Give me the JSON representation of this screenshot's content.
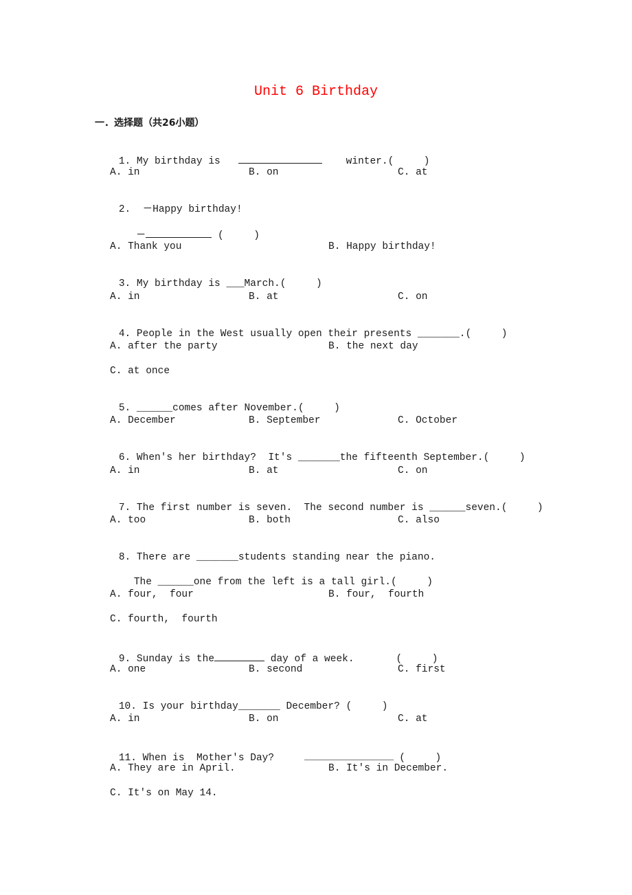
{
  "title": "Unit 6 Birthday",
  "section_heading": "一．选择题（共26小题）",
  "questions": [
    {
      "number": "1.",
      "text_before": "My birthday is",
      "text_after": "winter.",
      "paren": "(     )",
      "options": [
        "A. in",
        "B. on",
        "C. at"
      ]
    },
    {
      "number": "2.",
      "line1": "－Happy birthday!",
      "line2_prefix": "－",
      "paren": "(     )",
      "options": [
        "A. Thank you",
        "B. Happy birthday!"
      ]
    },
    {
      "number": "3.",
      "text": "My birthday is ___March.",
      "paren": "(     )",
      "options": [
        "A. in",
        "B. at",
        "C. on"
      ]
    },
    {
      "number": "4.",
      "text": "People in the West usually open their presents _______.",
      "paren": "(     )",
      "options": [
        "A. after the party",
        "B. the next day",
        "C. at once"
      ]
    },
    {
      "number": "5.",
      "text": "______comes after November.",
      "paren": "(     )",
      "options": [
        "A. December",
        "B. September",
        "C. October"
      ]
    },
    {
      "number": "6.",
      "text": "When's her birthday?  It's _______the fifteenth September.",
      "paren": "(     )",
      "options": [
        "A. in",
        "B. at",
        "C. on"
      ]
    },
    {
      "number": "7.",
      "text": "The first number is seven.  The second number is ______seven.",
      "paren": "(     )",
      "options": [
        "A. too",
        "B. both",
        "C. also"
      ]
    },
    {
      "number": "8.",
      "line1": "There are _______students standing near the piano.",
      "line2": "The ______one from the left is a tall girl.",
      "paren": "(     )",
      "options": [
        "A. four,  four",
        "B. four,  fourth",
        "C. fourth,  fourth"
      ]
    },
    {
      "number": "9.",
      "text_before": "Sunday is the",
      "text_after": " day of a week.",
      "paren": "(     )",
      "options": [
        "A. one",
        "B. second",
        "C. first"
      ]
    },
    {
      "number": "10.",
      "text": "Is your birthday_______ December?",
      "paren": "(     )",
      "options": [
        "A. in",
        "B. on",
        "C. at"
      ]
    },
    {
      "number": "11.",
      "text": "When is  Mother's Day?",
      "paren": "(     )",
      "options": [
        "A. They are in April.",
        "B. It's in December.",
        "C. It's on May 14."
      ]
    }
  ]
}
